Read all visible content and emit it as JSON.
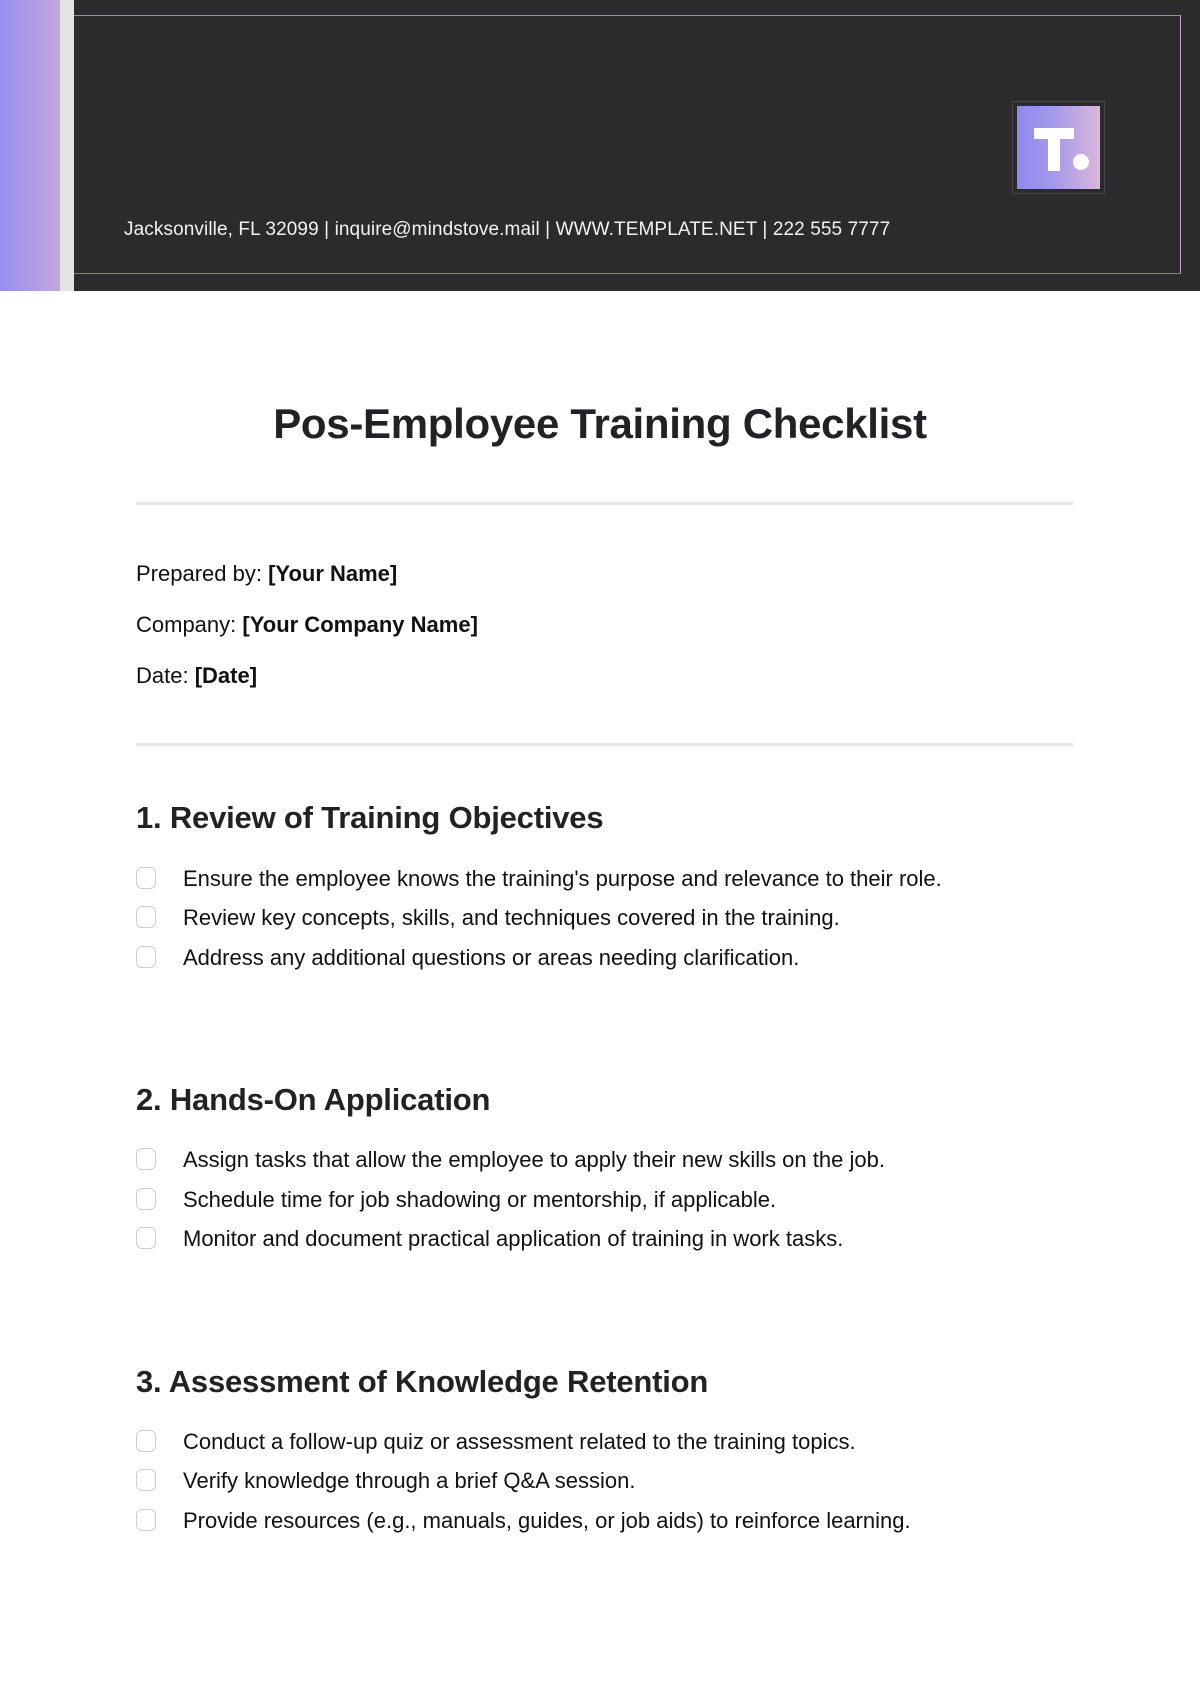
{
  "header": {
    "contact": "Jacksonville, FL 32099 | inquire@mindstove.mail | WWW.TEMPLATE.NET | 222 555 7777",
    "logo_letter": "T",
    "colors": {
      "background": "#2b2b2b",
      "accent_gradient_start": "#978ff0",
      "accent_gradient_end": "#dcb6dc"
    }
  },
  "document": {
    "title": "Pos-Employee Training Checklist",
    "meta": [
      {
        "label": "Prepared by: ",
        "value": "[Your Name]"
      },
      {
        "label": "Company: ",
        "value": "[Your Company Name]"
      },
      {
        "label": "Date: ",
        "value": "[Date]"
      }
    ],
    "sections": [
      {
        "heading": "1. Review of Training Objectives",
        "items": [
          {
            "text": "Ensure the employee knows the training's purpose and relevance to their role.",
            "checked": false
          },
          {
            "text": "Review key concepts, skills, and techniques covered in the training.",
            "checked": false
          },
          {
            "text": "Address any additional questions or areas needing clarification.",
            "checked": false
          }
        ]
      },
      {
        "heading": "2. Hands-On Application",
        "items": [
          {
            "text": "Assign tasks that allow the employee to apply their new skills on the job.",
            "checked": false
          },
          {
            "text": "Schedule time for job shadowing or mentorship, if applicable.",
            "checked": false
          },
          {
            "text": "Monitor and document practical application of training in work tasks.",
            "checked": false
          }
        ]
      },
      {
        "heading": "3. Assessment of Knowledge Retention",
        "items": [
          {
            "text": "Conduct a follow-up quiz or assessment related to the training topics.",
            "checked": false
          },
          {
            "text": "Verify knowledge through a brief Q&A session.",
            "checked": false
          },
          {
            "text": "Provide resources (e.g., manuals, guides, or job aids) to reinforce learning.",
            "checked": false
          }
        ]
      }
    ]
  }
}
